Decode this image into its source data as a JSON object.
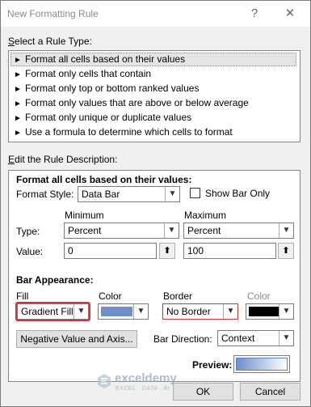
{
  "window": {
    "title": "New Formatting Rule",
    "help_glyph": "?",
    "close_glyph": "✕"
  },
  "rule_type": {
    "label": "Select a Rule Type:",
    "items": [
      "Format all cells based on their values",
      "Format only cells that contain",
      "Format only top or bottom ranked values",
      "Format only values that are above or below average",
      "Format only unique or duplicate values",
      "Use a formula to determine which cells to format"
    ],
    "selected_index": 0,
    "arrow_glyph": "►"
  },
  "description": {
    "label": "Edit the Rule Description:",
    "heading": "Format all cells based on their values:",
    "format_style_label": "Format Style:",
    "format_style_value": "Data Bar",
    "show_bar_only_label": "Show Bar Only",
    "show_bar_only_checked": false,
    "minimum_label": "Minimum",
    "maximum_label": "Maximum",
    "type_label": "Type:",
    "value_label": "Value:",
    "min_type": "Percent",
    "max_type": "Percent",
    "min_value": "0",
    "max_value": "100",
    "ref_glyph": "⬆"
  },
  "bar_appearance": {
    "heading": "Bar Appearance:",
    "fill_label": "Fill",
    "fill_value": "Gradient Fill",
    "color_label": "Color",
    "fill_color": "#6e8fc9",
    "border_label": "Border",
    "border_value": "No Border",
    "border_color_label": "Color",
    "border_color": "#000000",
    "negative_button": "Negative Value and Axis...",
    "bar_direction_label": "Bar Direction:",
    "bar_direction_value": "Context",
    "preview_label": "Preview:"
  },
  "buttons": {
    "ok": "OK",
    "cancel": "Cancel"
  },
  "watermark": {
    "name": "exceldemy",
    "tagline": "EXCEL · DATA · BI"
  }
}
